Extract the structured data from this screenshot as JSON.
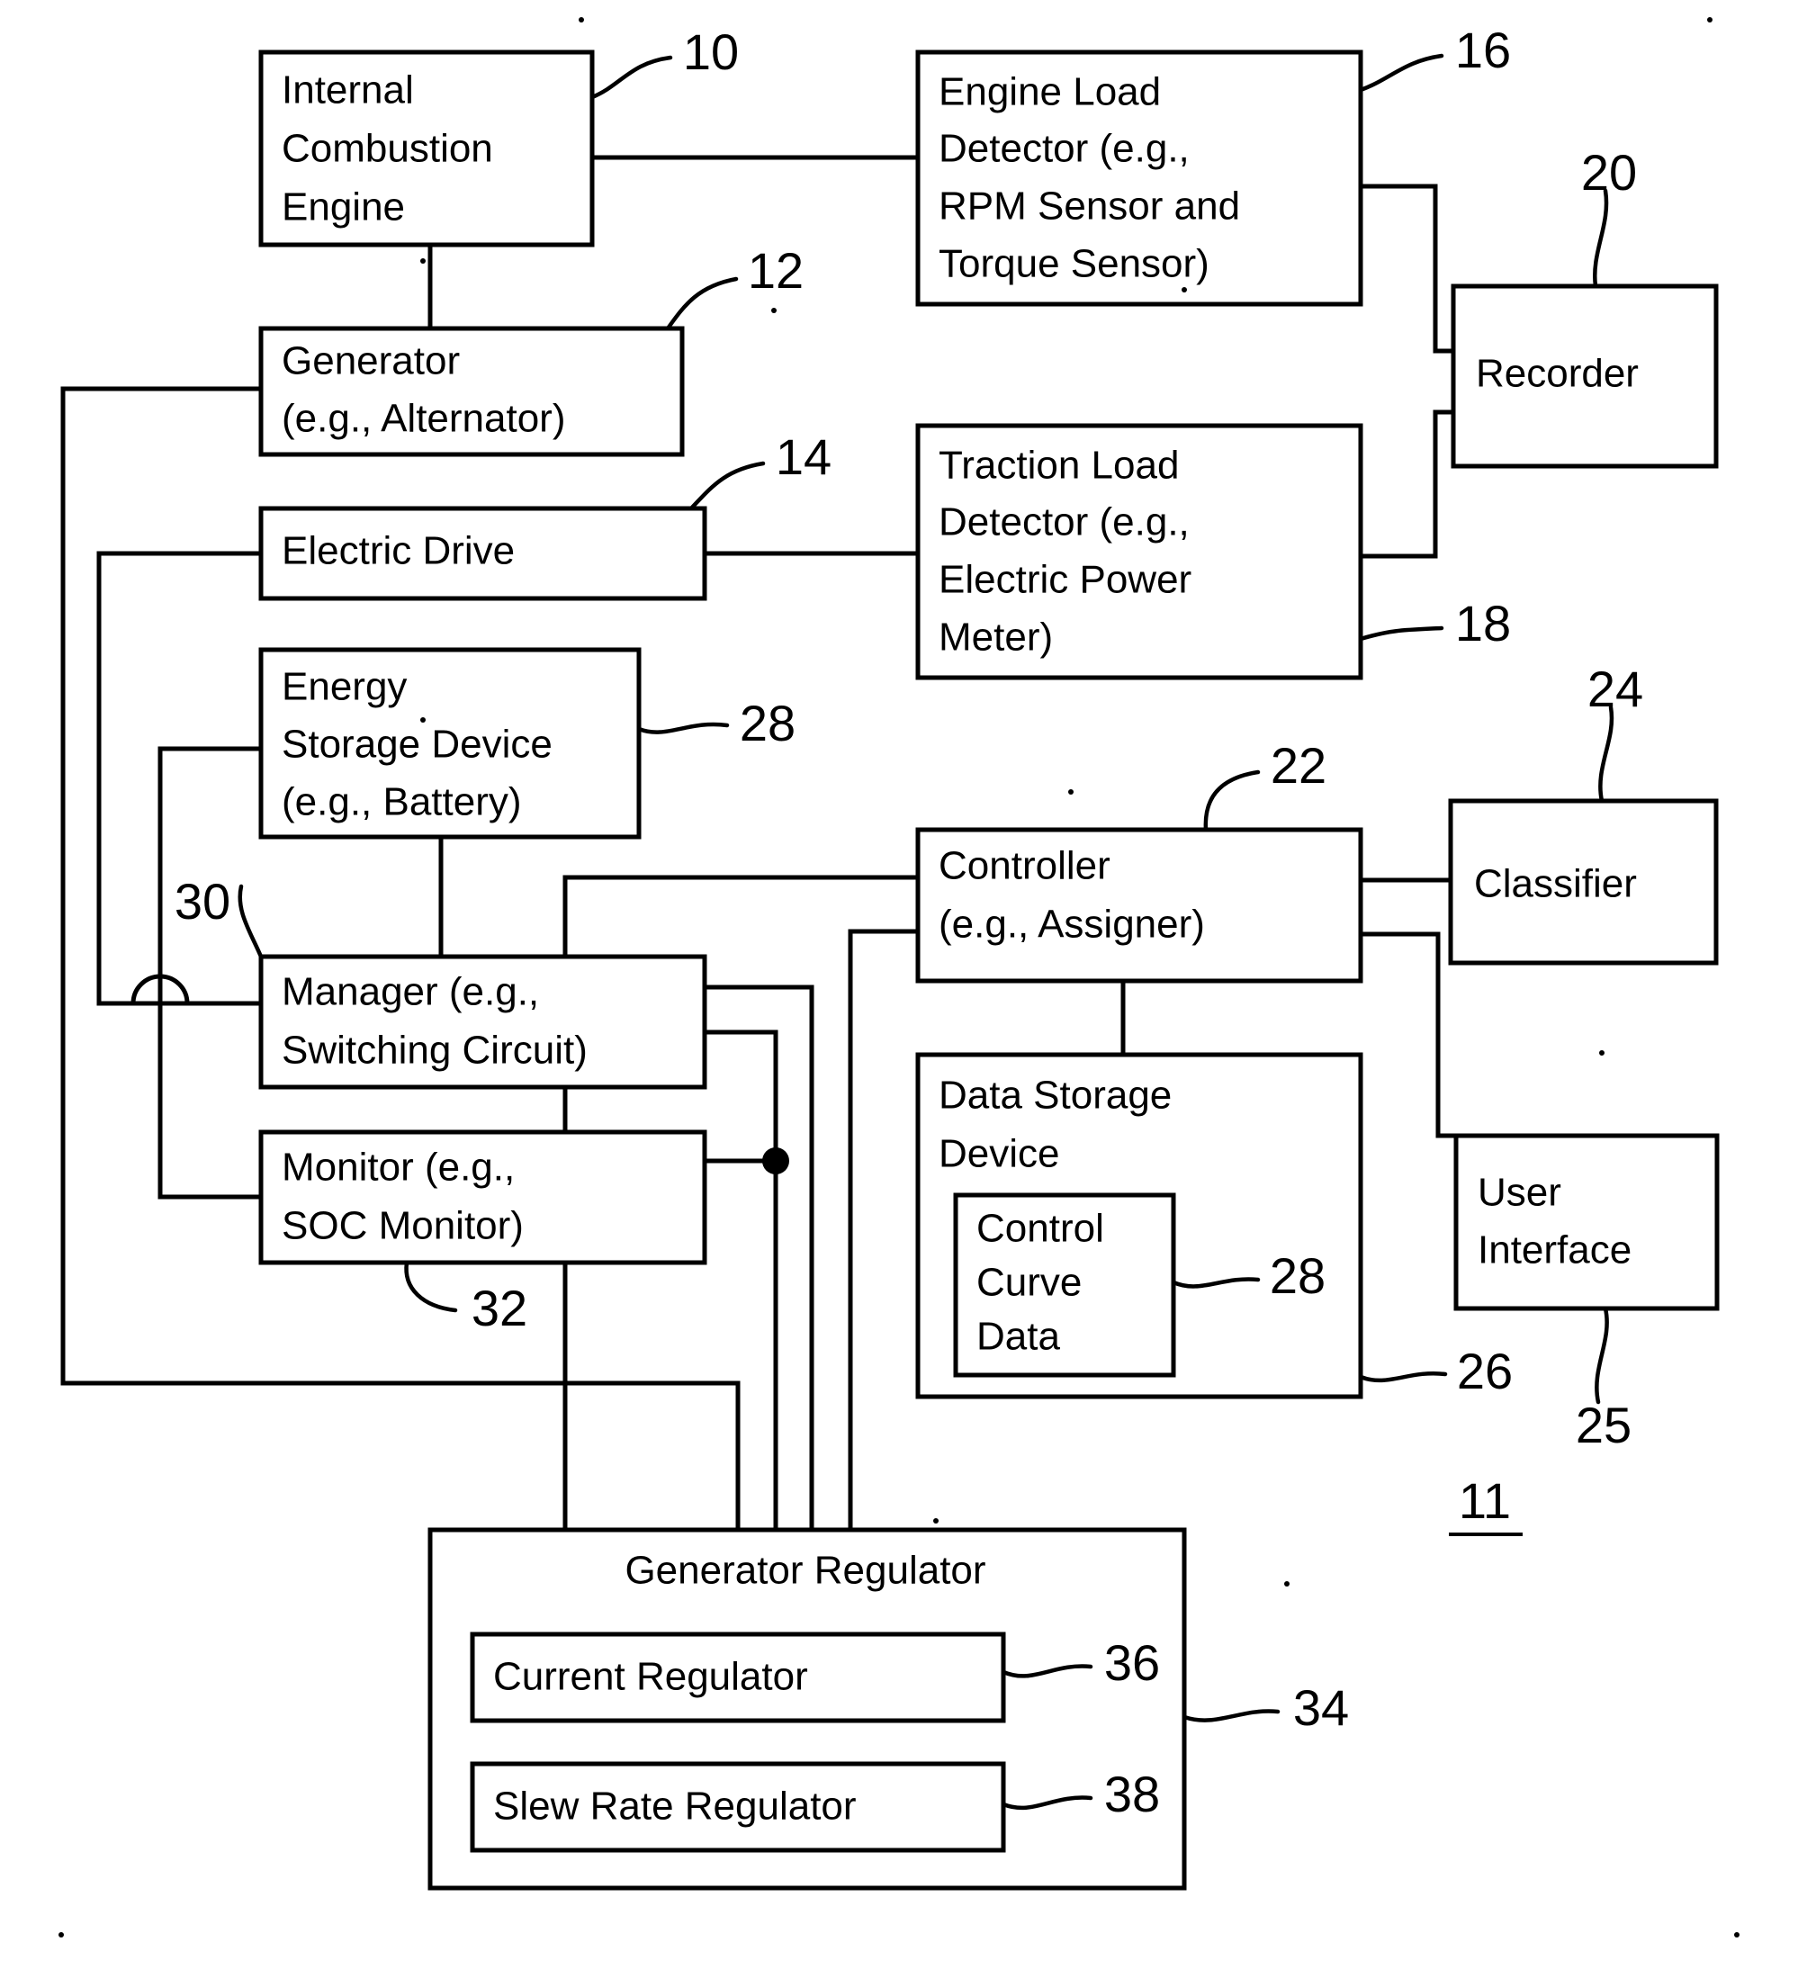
{
  "figure": {
    "figure_label": "11",
    "nodes": [
      {
        "id": "engine",
        "ref": "10",
        "lines": [
          "Internal",
          "Combustion",
          "Engine"
        ]
      },
      {
        "id": "generator",
        "ref": "12",
        "lines": [
          "Generator",
          "(e.g., Alternator)"
        ]
      },
      {
        "id": "electricdrive",
        "ref": "14",
        "lines": [
          "Electric Drive"
        ]
      },
      {
        "id": "engineload",
        "ref": "16",
        "lines": [
          "Engine Load",
          "Detector (e.g.,",
          "RPM Sensor and",
          "Torque Sensor)"
        ]
      },
      {
        "id": "tractionload",
        "ref": "18",
        "lines": [
          "Traction Load",
          "Detector (e.g.,",
          "Electric Power",
          "Meter)"
        ]
      },
      {
        "id": "recorder",
        "ref": "20",
        "lines": [
          "Recorder"
        ]
      },
      {
        "id": "energystorage",
        "ref": "28",
        "lines": [
          "Energy",
          "Storage Device",
          "(e.g., Battery)"
        ]
      },
      {
        "id": "manager",
        "ref": "30",
        "lines": [
          "Manager (e.g.,",
          "Switching Circuit)"
        ]
      },
      {
        "id": "monitor",
        "ref": "32",
        "lines": [
          "Monitor (e.g.,",
          "SOC Monitor)"
        ]
      },
      {
        "id": "controller",
        "ref": "22",
        "lines": [
          "Controller",
          "(e.g., Assigner)"
        ]
      },
      {
        "id": "classifier",
        "ref": "24",
        "lines": [
          "Classifier"
        ]
      },
      {
        "id": "datastorage",
        "ref": "26",
        "lines": [
          "Data Storage",
          "Device"
        ]
      },
      {
        "id": "controlcurve",
        "ref": "28",
        "lines": [
          "Control",
          "Curve",
          "Data"
        ]
      },
      {
        "id": "userinterface",
        "ref": "25",
        "lines": [
          "User",
          "Interface"
        ]
      },
      {
        "id": "genregulator",
        "ref": "34",
        "lines": [
          "Generator Regulator"
        ]
      },
      {
        "id": "currentreg",
        "ref": "36",
        "lines": [
          "Current Regulator"
        ]
      },
      {
        "id": "slewreg",
        "ref": "38",
        "lines": [
          "Slew Rate Regulator"
        ]
      }
    ],
    "labels": {
      "engine_l1": "Internal",
      "engine_l2": "Combustion",
      "engine_l3": "Engine",
      "generator_l1": "Generator",
      "generator_l2": "(e.g., Alternator)",
      "electricdrive_l1": "Electric Drive",
      "engineload_l1": "Engine Load",
      "engineload_l2": "Detector (e.g.,",
      "engineload_l3": "RPM Sensor and",
      "engineload_l4": "Torque Sensor)",
      "tractionload_l1": "Traction Load",
      "tractionload_l2": "Detector (e.g.,",
      "tractionload_l3": "Electric Power",
      "tractionload_l4": "Meter)",
      "recorder_l1": "Recorder",
      "energystorage_l1": "Energy",
      "energystorage_l2": "Storage Device",
      "energystorage_l3": "(e.g., Battery)",
      "manager_l1": "Manager (e.g.,",
      "manager_l2": "Switching Circuit)",
      "monitor_l1": "Monitor (e.g.,",
      "monitor_l2": "SOC Monitor)",
      "controller_l1": "Controller",
      "controller_l2": "(e.g., Assigner)",
      "classifier_l1": "Classifier",
      "datastorage_l1": "Data Storage",
      "datastorage_l2": "Device",
      "controlcurve_l1": "Control",
      "controlcurve_l2": "Curve",
      "controlcurve_l3": "Data",
      "userinterface_l1": "User",
      "userinterface_l2": "Interface",
      "genregulator_l1": "Generator Regulator",
      "currentreg_l1": "Current Regulator",
      "slewreg_l1": "Slew Rate Regulator"
    },
    "refs": {
      "r10": "10",
      "r12": "12",
      "r14": "14",
      "r16": "16",
      "r18": "18",
      "r20": "20",
      "r22": "22",
      "r24": "24",
      "r25": "25",
      "r26": "26",
      "r28_battery": "28",
      "r28_curve": "28",
      "r30": "30",
      "r32": "32",
      "r34": "34",
      "r36": "36",
      "r38": "38",
      "fig": "11"
    },
    "colors": {
      "line": "#000000",
      "fill": "#ffffff"
    }
  }
}
